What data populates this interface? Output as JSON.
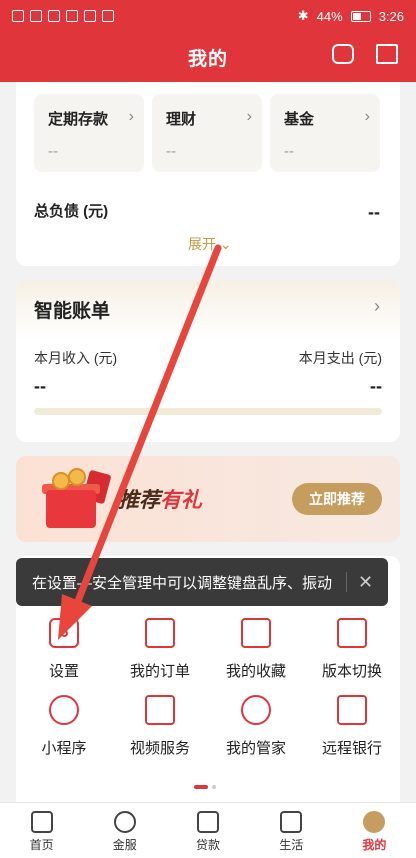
{
  "status_bar": {
    "battery": "44%",
    "time": "3:26"
  },
  "header": {
    "title": "我的"
  },
  "assets": {
    "items": [
      {
        "title": "定期存款",
        "value": "--"
      },
      {
        "title": "理财",
        "value": "--"
      },
      {
        "title": "基金",
        "value": "--"
      }
    ],
    "debt_label": "总负债 (元)",
    "debt_value": "--",
    "expand_label": "展开"
  },
  "bill": {
    "title": "智能账单",
    "income_label": "本月收入 (元)",
    "income_value": "--",
    "expense_label": "本月支出 (元)",
    "expense_value": "--"
  },
  "promo": {
    "text_a": "推荐",
    "text_b": "有礼",
    "button": "立即推荐"
  },
  "tooltip": {
    "text": "在设置—安全管理中可以调整键盘乱序、振动"
  },
  "services": [
    {
      "label": "设置",
      "icon": "settings-icon"
    },
    {
      "label": "我的订单",
      "icon": "order-icon"
    },
    {
      "label": "我的收藏",
      "icon": "favorite-icon"
    },
    {
      "label": "版本切换",
      "icon": "switch-icon"
    },
    {
      "label": "小程序",
      "icon": "mini-program-icon"
    },
    {
      "label": "视频服务",
      "icon": "video-icon"
    },
    {
      "label": "我的管家",
      "icon": "butler-icon"
    },
    {
      "label": "远程银行",
      "icon": "remote-bank-icon"
    }
  ],
  "tabs": [
    {
      "label": "首页",
      "icon": "home-icon"
    },
    {
      "label": "金服",
      "icon": "heart-icon"
    },
    {
      "label": "贷款",
      "icon": "loan-icon"
    },
    {
      "label": "生活",
      "icon": "life-icon"
    },
    {
      "label": "我的",
      "icon": "mine-icon"
    }
  ],
  "colors": {
    "brand": "#e0353b",
    "gold": "#c59d5f",
    "tooltip": "#3a3a3a"
  }
}
